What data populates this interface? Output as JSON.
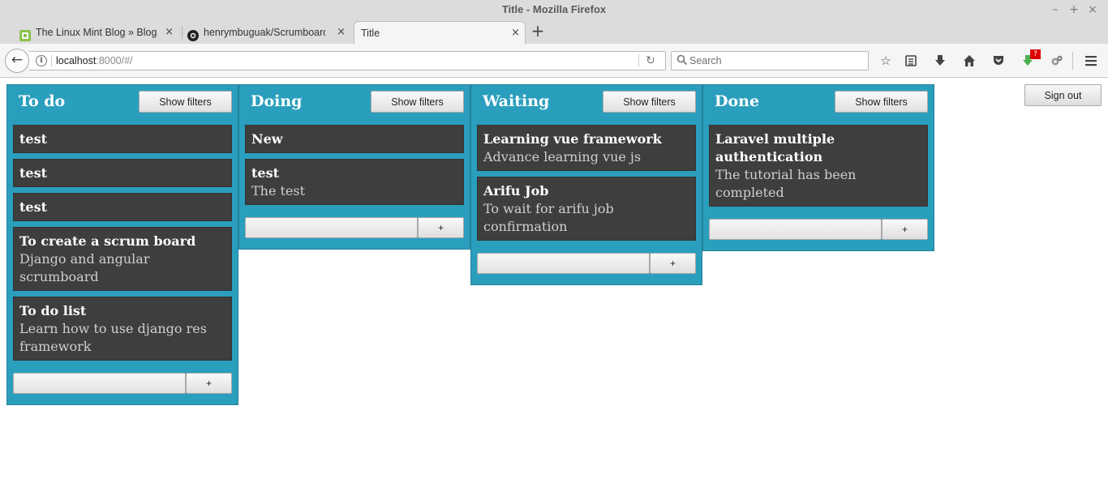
{
  "window": {
    "title": "Title - Mozilla Firefox"
  },
  "tabs": [
    {
      "label": "The Linux Mint Blog » Blog Archive",
      "icon": "linux-mint-favicon",
      "active": false
    },
    {
      "label": "henrymbuguak/Scrumboard",
      "icon": "github-favicon",
      "active": false
    },
    {
      "label": "Title",
      "icon": "",
      "active": true
    }
  ],
  "navbar": {
    "url_host": "localhost",
    "url_rest": ":8000/#/",
    "search_placeholder": "Search",
    "badge_count": "?"
  },
  "page": {
    "signout_label": "Sign out",
    "filters_label": "Show filters",
    "add_label": "+"
  },
  "columns": [
    {
      "title": "To do",
      "cards": [
        {
          "title": "test",
          "description": ""
        },
        {
          "title": "test",
          "description": ""
        },
        {
          "title": "test",
          "description": ""
        },
        {
          "title": "To create a scrum board",
          "description": "Django and angular scrumboard"
        },
        {
          "title": "To do list",
          "description": "Learn how to use django res framework"
        }
      ]
    },
    {
      "title": "Doing",
      "cards": [
        {
          "title": "New",
          "description": ""
        },
        {
          "title": "test",
          "description": "The test"
        }
      ]
    },
    {
      "title": "Waiting",
      "cards": [
        {
          "title": "Learning vue framework",
          "description": "Advance learning vue js"
        },
        {
          "title": "Arifu Job",
          "description": "To wait for arifu job confirmation"
        }
      ]
    },
    {
      "title": "Done",
      "cards": [
        {
          "title": "Laravel multiple authentication",
          "description": "The tutorial has been completed"
        }
      ]
    }
  ],
  "colors": {
    "column_bg": "#2a9fbd",
    "card_bg": "#3e3e3e",
    "badge": "#dd0000"
  }
}
